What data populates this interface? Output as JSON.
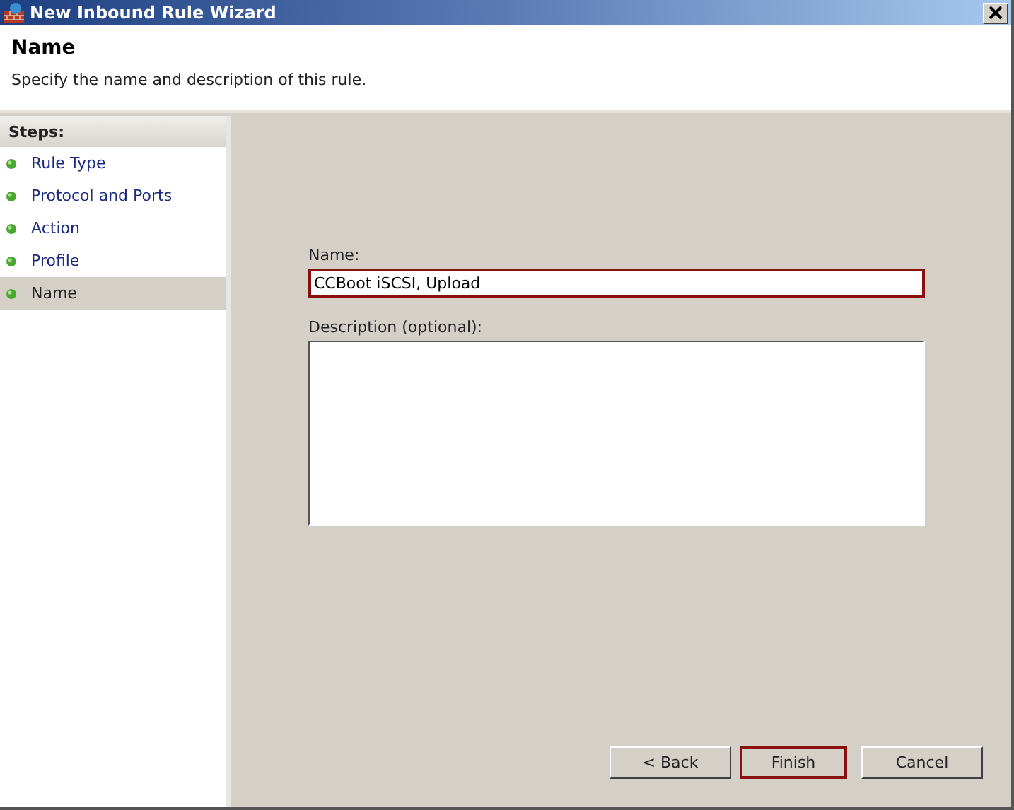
{
  "window": {
    "title": "New Inbound Rule Wizard"
  },
  "header": {
    "title": "Name",
    "subtitle": "Specify the name and description of this rule."
  },
  "steps": {
    "title": "Steps:",
    "items": [
      {
        "label": "Rule Type",
        "selected": false
      },
      {
        "label": "Protocol and Ports",
        "selected": false
      },
      {
        "label": "Action",
        "selected": false
      },
      {
        "label": "Profile",
        "selected": false
      },
      {
        "label": "Name",
        "selected": true
      }
    ]
  },
  "form": {
    "name_label": "Name:",
    "name_value": "CCBoot iSCSI, Upload",
    "name_focused": true,
    "description_label": "Description (optional):"
  },
  "buttons": [
    {
      "label": "< Back",
      "default": false
    },
    {
      "label": "Finish",
      "default": true
    },
    {
      "label": "Cancel",
      "default": false
    }
  ]
}
